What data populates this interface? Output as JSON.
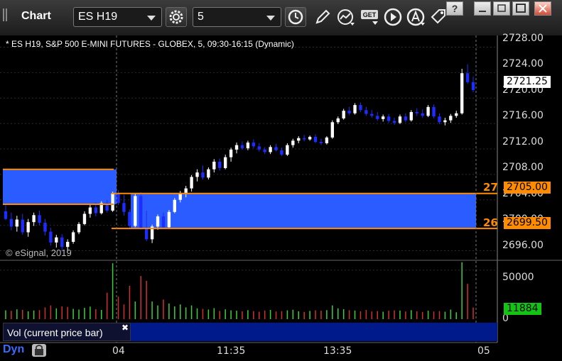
{
  "window": {
    "title": "Chart"
  },
  "toolbar": {
    "symbol": "ES H19",
    "interval": "5",
    "icons": [
      "settings-gear-icon",
      "clock-icon",
      "pencil-icon",
      "chart-line-icon",
      "get-icon",
      "play-icon",
      "alert-icon",
      "tag-icon",
      "split-icon"
    ]
  },
  "chart": {
    "header": "* ES H19, S&P 500 E-MINI FUTURES - GLOBEX, 5, 09:30-16:15 (Dynamic)",
    "copyright": "© eSignal, 2019",
    "price_axis": [
      "2728.00",
      "2724.00",
      "2720.00",
      "2716.00",
      "2712.00",
      "2708.00",
      "2704.00",
      "2700.00",
      "2696.00"
    ],
    "volume_axis": [
      "50000",
      "0"
    ],
    "time_axis": [
      "04",
      "11:35",
      "13:35",
      "05"
    ],
    "last_price": "2721.25",
    "last_volume": "11884",
    "level_high_label": "2705.00",
    "level_low_label": "2699.50",
    "level_high_cut": "27",
    "level_low_cut": "26",
    "colors": {
      "up": "#ffffff",
      "down": "#1e2dff",
      "zone": "#2a5cff",
      "level": "#ff8c00",
      "vol_up": "#3ccf3c",
      "vol_down": "#d03030"
    }
  },
  "chart_data": {
    "type": "candlestick",
    "price_range": [
      2694.5,
      2729.5
    ],
    "volume_range": [
      0,
      60000
    ],
    "levels": [
      2705.0,
      2699.5
    ],
    "prior_zone": [
      2703.3,
      2708.8
    ],
    "bars": [
      [
        2702.2,
        2703.5,
        2700.8,
        2701.0
      ],
      [
        2701.0,
        2702.0,
        2699.2,
        2699.8
      ],
      [
        2699.8,
        2701.5,
        2699.0,
        2700.9
      ],
      [
        2700.9,
        2701.8,
        2698.5,
        2698.9
      ],
      [
        2698.9,
        2701.0,
        2698.2,
        2700.5
      ],
      [
        2700.5,
        2702.0,
        2699.9,
        2701.6
      ],
      [
        2701.6,
        2702.3,
        2700.0,
        2700.4
      ],
      [
        2700.4,
        2701.0,
        2698.4,
        2699.0
      ],
      [
        2699.0,
        2699.6,
        2696.8,
        2697.3
      ],
      [
        2697.3,
        2698.5,
        2696.5,
        2698.1
      ],
      [
        2698.1,
        2698.6,
        2696.0,
        2696.6
      ],
      [
        2696.6,
        2697.8,
        2695.9,
        2697.4
      ],
      [
        2697.4,
        2699.2,
        2697.1,
        2698.9
      ],
      [
        2698.9,
        2700.5,
        2698.6,
        2700.2
      ],
      [
        2700.2,
        2702.2,
        2700.0,
        2701.8
      ],
      [
        2701.8,
        2703.2,
        2701.2,
        2702.8
      ],
      [
        2702.8,
        2703.6,
        2701.4,
        2701.9
      ],
      [
        2701.9,
        2703.8,
        2701.7,
        2703.5
      ],
      [
        2703.5,
        2704.0,
        2702.0,
        2702.3
      ],
      [
        2702.3,
        2705.3,
        2702.1,
        2705.0
      ],
      [
        2705.0,
        2705.5,
        2703.2,
        2703.5
      ],
      [
        2703.5,
        2704.8,
        2701.5,
        2702.1
      ],
      [
        2702.1,
        2702.5,
        2699.6,
        2699.9
      ],
      [
        2699.9,
        2705.0,
        2699.7,
        2704.6
      ],
      [
        2704.6,
        2705.2,
        2699.3,
        2699.6
      ],
      [
        2699.6,
        2702.3,
        2697.5,
        2697.8
      ],
      [
        2697.8,
        2700.1,
        2697.2,
        2699.8
      ],
      [
        2699.8,
        2701.7,
        2699.3,
        2701.4
      ],
      [
        2701.4,
        2702.0,
        2699.4,
        2699.7
      ],
      [
        2699.7,
        2702.4,
        2699.6,
        2702.1
      ],
      [
        2702.1,
        2704.3,
        2701.9,
        2704.0
      ],
      [
        2704.0,
        2705.4,
        2703.6,
        2705.1
      ],
      [
        2705.1,
        2706.2,
        2704.4,
        2705.8
      ],
      [
        2705.8,
        2707.9,
        2705.3,
        2707.6
      ],
      [
        2707.6,
        2708.8,
        2706.9,
        2708.3
      ],
      [
        2708.3,
        2709.4,
        2707.2,
        2707.5
      ],
      [
        2707.5,
        2709.1,
        2707.2,
        2708.8
      ],
      [
        2708.8,
        2710.4,
        2708.3,
        2710.0
      ],
      [
        2710.0,
        2710.5,
        2708.6,
        2709.0
      ],
      [
        2709.0,
        2711.1,
        2708.8,
        2710.7
      ],
      [
        2710.7,
        2712.2,
        2710.0,
        2711.9
      ],
      [
        2711.9,
        2713.0,
        2711.3,
        2712.6
      ],
      [
        2712.6,
        2713.2,
        2711.9,
        2712.1
      ],
      [
        2712.1,
        2713.3,
        2711.8,
        2713.0
      ],
      [
        2713.0,
        2713.5,
        2712.1,
        2712.4
      ],
      [
        2712.4,
        2712.9,
        2711.6,
        2711.9
      ],
      [
        2711.9,
        2712.3,
        2711.2,
        2711.5
      ],
      [
        2711.5,
        2712.6,
        2711.2,
        2712.3
      ],
      [
        2712.3,
        2712.8,
        2711.6,
        2711.8
      ],
      [
        2711.8,
        2712.2,
        2710.9,
        2711.1
      ],
      [
        2711.1,
        2712.9,
        2710.9,
        2712.6
      ],
      [
        2712.6,
        2713.6,
        2712.2,
        2713.3
      ],
      [
        2713.3,
        2714.0,
        2712.9,
        2713.7
      ],
      [
        2713.7,
        2714.2,
        2713.2,
        2713.5
      ],
      [
        2713.5,
        2714.1,
        2713.3,
        2713.9
      ],
      [
        2713.9,
        2714.3,
        2712.9,
        2713.1
      ],
      [
        2713.1,
        2713.6,
        2712.6,
        2712.9
      ],
      [
        2712.9,
        2714.0,
        2712.7,
        2713.8
      ],
      [
        2713.8,
        2716.5,
        2713.6,
        2716.2
      ],
      [
        2716.2,
        2717.1,
        2715.9,
        2716.8
      ],
      [
        2716.8,
        2718.3,
        2716.6,
        2718.0
      ],
      [
        2718.0,
        2718.6,
        2717.3,
        2717.6
      ],
      [
        2717.6,
        2719.2,
        2717.4,
        2718.9
      ],
      [
        2718.9,
        2719.3,
        2717.8,
        2718.1
      ],
      [
        2718.1,
        2718.6,
        2717.2,
        2717.5
      ],
      [
        2717.5,
        2718.1,
        2716.9,
        2717.2
      ],
      [
        2717.2,
        2717.8,
        2716.4,
        2716.7
      ],
      [
        2716.7,
        2717.4,
        2716.3,
        2717.1
      ],
      [
        2717.1,
        2717.5,
        2716.1,
        2716.4
      ],
      [
        2716.4,
        2716.9,
        2715.8,
        2716.1
      ],
      [
        2716.1,
        2717.4,
        2715.9,
        2717.1
      ],
      [
        2717.1,
        2717.6,
        2716.2,
        2716.5
      ],
      [
        2716.5,
        2718.1,
        2716.3,
        2717.8
      ],
      [
        2717.8,
        2718.4,
        2717.2,
        2717.6
      ],
      [
        2717.6,
        2718.2,
        2716.9,
        2717.2
      ],
      [
        2717.2,
        2718.9,
        2717.0,
        2718.6
      ],
      [
        2718.6,
        2719.0,
        2716.8,
        2717.1
      ],
      [
        2717.1,
        2717.6,
        2715.9,
        2716.2
      ],
      [
        2716.2,
        2716.9,
        2715.7,
        2716.5
      ],
      [
        2716.5,
        2717.5,
        2716.1,
        2717.2
      ],
      [
        2717.2,
        2718.0,
        2716.9,
        2717.6
      ],
      [
        2717.6,
        2724.6,
        2717.4,
        2723.9
      ],
      [
        2723.9,
        2725.3,
        2722.2,
        2722.5
      ],
      [
        2722.5,
        2723.4,
        2720.9,
        2721.25
      ]
    ],
    "volume": [
      [
        9000,
        0
      ],
      [
        8500,
        1
      ],
      [
        10000,
        0
      ],
      [
        9500,
        1
      ],
      [
        8000,
        0
      ],
      [
        8800,
        0
      ],
      [
        9200,
        1
      ],
      [
        12000,
        1
      ],
      [
        14000,
        1
      ],
      [
        11000,
        0
      ],
      [
        13000,
        1
      ],
      [
        12500,
        1
      ],
      [
        10500,
        0
      ],
      [
        9800,
        0
      ],
      [
        11500,
        0
      ],
      [
        12800,
        0
      ],
      [
        10200,
        1
      ],
      [
        9400,
        0
      ],
      [
        27000,
        1
      ],
      [
        57000,
        0
      ],
      [
        23000,
        1
      ],
      [
        15000,
        1
      ],
      [
        34000,
        1
      ],
      [
        18000,
        0
      ],
      [
        44000,
        1
      ],
      [
        39000,
        1
      ],
      [
        18000,
        0
      ],
      [
        14000,
        0
      ],
      [
        20000,
        1
      ],
      [
        16000,
        0
      ],
      [
        13000,
        0
      ],
      [
        15000,
        0
      ],
      [
        12000,
        0
      ],
      [
        14000,
        0
      ],
      [
        11000,
        0
      ],
      [
        10500,
        1
      ],
      [
        9800,
        0
      ],
      [
        11200,
        0
      ],
      [
        8400,
        1
      ],
      [
        10000,
        0
      ],
      [
        9000,
        0
      ],
      [
        8600,
        0
      ],
      [
        8000,
        1
      ],
      [
        9200,
        0
      ],
      [
        8200,
        1
      ],
      [
        7600,
        1
      ],
      [
        8800,
        1
      ],
      [
        9400,
        0
      ],
      [
        7800,
        1
      ],
      [
        8200,
        1
      ],
      [
        9000,
        0
      ],
      [
        9600,
        0
      ],
      [
        8000,
        0
      ],
      [
        7400,
        1
      ],
      [
        8400,
        0
      ],
      [
        9000,
        1
      ],
      [
        8600,
        1
      ],
      [
        9200,
        0
      ],
      [
        14000,
        0
      ],
      [
        11000,
        0
      ],
      [
        10200,
        0
      ],
      [
        9200,
        1
      ],
      [
        8800,
        0
      ],
      [
        8000,
        1
      ],
      [
        9400,
        1
      ],
      [
        7800,
        1
      ],
      [
        8200,
        1
      ],
      [
        7600,
        0
      ],
      [
        8600,
        1
      ],
      [
        9000,
        1
      ],
      [
        8800,
        0
      ],
      [
        7800,
        1
      ],
      [
        9200,
        0
      ],
      [
        8000,
        1
      ],
      [
        7400,
        1
      ],
      [
        8600,
        0
      ],
      [
        7800,
        1
      ],
      [
        8200,
        1
      ],
      [
        7600,
        0
      ],
      [
        9800,
        0
      ],
      [
        7000,
        0
      ],
      [
        58000,
        0
      ],
      [
        36000,
        1
      ],
      [
        11884,
        1
      ]
    ]
  }
}
